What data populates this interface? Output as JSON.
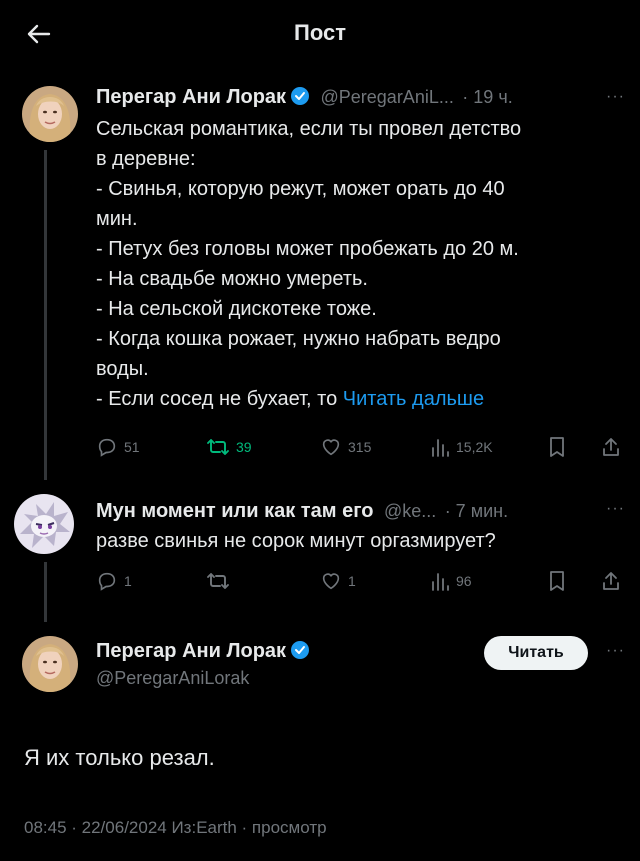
{
  "header": {
    "title": "Пост"
  },
  "post1": {
    "author_name": "Перегар Ани Лорак",
    "handle": "@PeregarAniL...",
    "time": "· 19 ч.",
    "lines": [
      "Сельская романтика, если ты провел детство",
      "в деревне:",
      "- Свинья, которую режут, может орать до 40",
      "мин.",
      "- Петух без головы может пробежать до 20 м.",
      "- На свадьбе можно умереть.",
      "- На сельской дискотеке тоже.",
      "- Когда кошка рожает, нужно набрать ведро",
      "воды.",
      "- Если сосед не бухает, то "
    ],
    "read_more": "Читать дальше",
    "replies": "51",
    "reposts": "39",
    "likes": "315",
    "views": "15,2K"
  },
  "post2": {
    "author_name": "Мун момент или как там его",
    "handle": "@ke...",
    "time": "· 7 мин.",
    "text": "разве свинья не сорок минут оргазмирует?",
    "replies": "1",
    "reposts": "",
    "likes": "1",
    "views": "96"
  },
  "post3": {
    "author_name": "Перегар Ани Лорак",
    "handle": "@PeregarAniLorak",
    "follow_label": "Читать",
    "text": "Я их только резал.",
    "footer": "08:45 · 22/06/2024 Из:Earth · просмотр"
  },
  "colors": {
    "accent": "#1d9bf0",
    "repost_active": "#00ba7c",
    "muted": "#71767b"
  },
  "icons": [
    "back-arrow-icon",
    "verified-badge-icon",
    "reply-icon",
    "repost-icon",
    "like-icon",
    "views-icon",
    "bookmark-icon",
    "share-icon",
    "more-icon"
  ]
}
